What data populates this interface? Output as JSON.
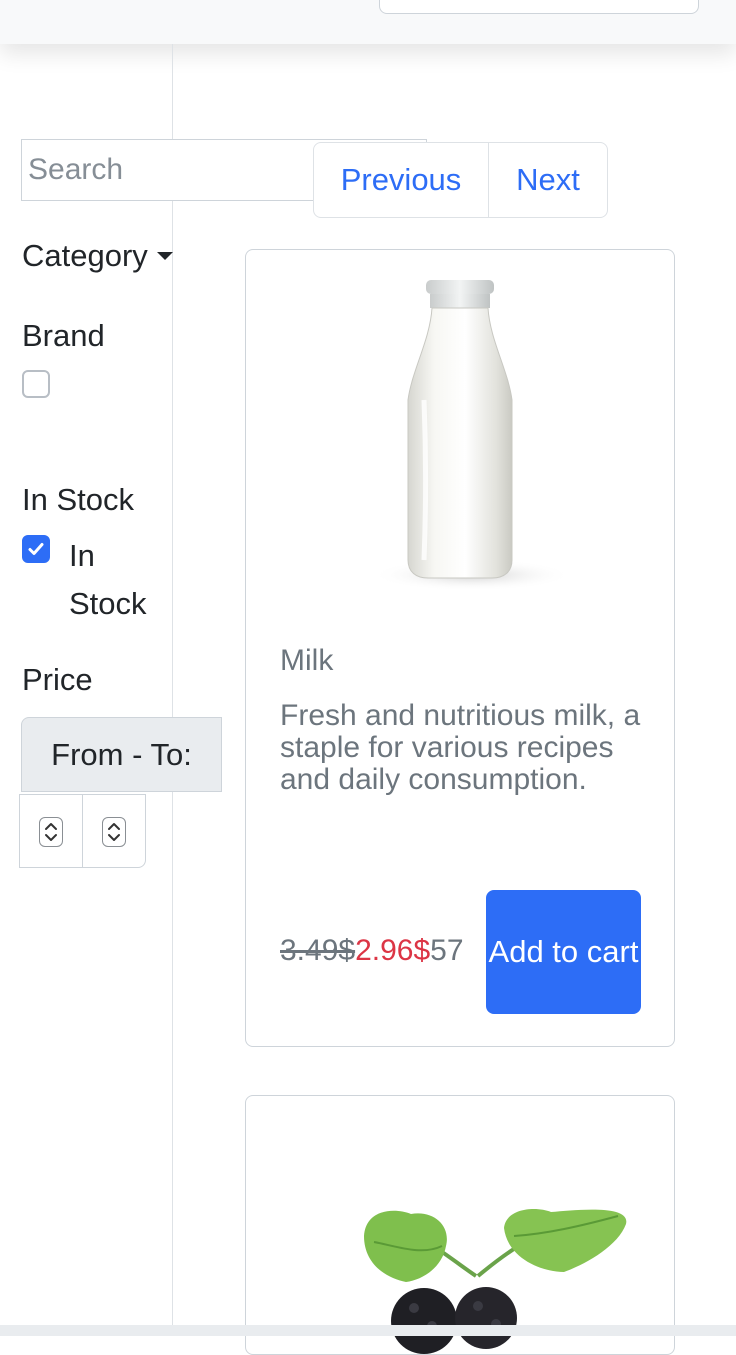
{
  "search": {
    "placeholder": "Search",
    "value": ""
  },
  "pagination": {
    "previous_label": "Previous",
    "next_label": "Next"
  },
  "filters": {
    "category_label": "Category",
    "brand_heading": "Brand",
    "brand_checked": false,
    "in_stock_heading": "In Stock",
    "in_stock_option_label": "In Stock",
    "in_stock_checked": true,
    "price_heading": "Price",
    "price_range_label": "From - To:",
    "price_from_value": "",
    "price_to_value": ""
  },
  "products": [
    {
      "name": "Milk",
      "description": "Fresh and nutritious milk, a staple for various recipes and daily consumption.",
      "old_price": "3.49$",
      "new_price": "2.96$",
      "extra_text": "57",
      "button_label": "Add to cart",
      "image_icon": "milk-bottle-image"
    },
    {
      "image_icon": "mulberries-image"
    }
  ],
  "colors": {
    "primary": "#2d6df6",
    "sale_price": "#dc3545",
    "muted_text": "#6c757d",
    "border": "#ced4da"
  }
}
